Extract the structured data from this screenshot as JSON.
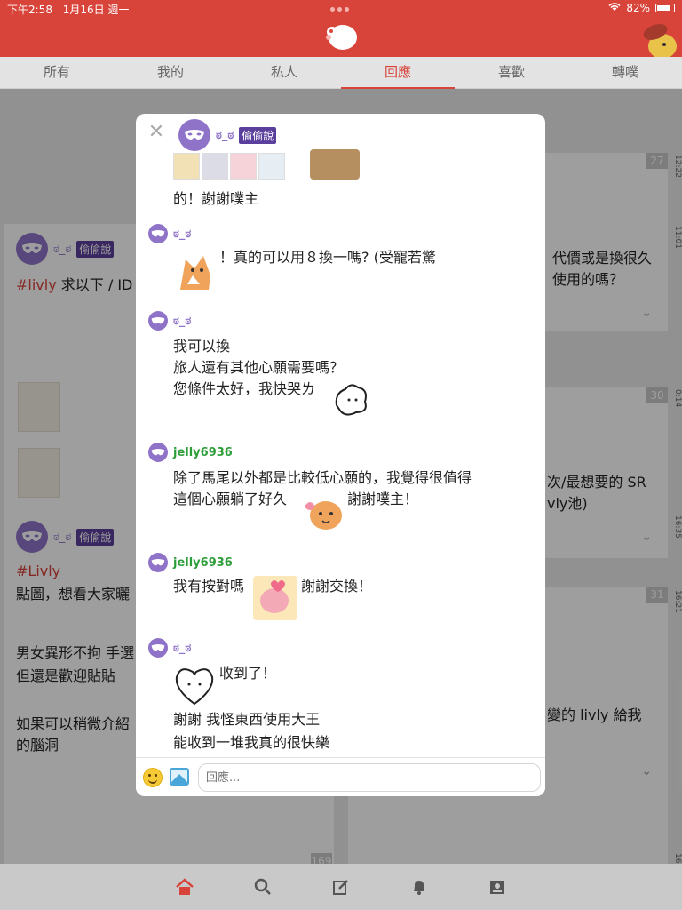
{
  "status": {
    "time": "下午2:58",
    "date": "1月16日 週一",
    "battery": "82%"
  },
  "tabs": [
    {
      "label": "所有",
      "active": false
    },
    {
      "label": "我的",
      "active": false
    },
    {
      "label": "私人",
      "active": false
    },
    {
      "label": "回應",
      "active": true
    },
    {
      "label": "喜歡",
      "active": false
    },
    {
      "label": "轉噗",
      "active": false
    }
  ],
  "feed": {
    "post1": {
      "name": "ಠ_ಠ",
      "badge": "偷偷說",
      "tag": "#livly",
      "text": " 求以下 / ID 內",
      "like_count": "",
      "timestamp": "11:01"
    },
    "post2": {
      "name": "ಠ_ಠ",
      "badge": "偷偷說",
      "tag": "#Livly",
      "line1": "點圖，想看大家曬",
      "line2": "男女異形不拘 手選",
      "line3": "但還是歡迎貼貼",
      "line4": "如果可以稍微介紹",
      "line5": "的腦洞",
      "like_count": "7"
    },
    "right1": {
      "count": "27",
      "time": "12:22",
      "line1": "代價或是換很久",
      "line2": "使用的嗎？"
    },
    "right2": {
      "count": "30",
      "time": "0:14",
      "line1": "次/最想要的 SR",
      "line2": "vly池)",
      "time2": "16:35"
    },
    "right3": {
      "count": "31",
      "time": "16:21",
      "line1": "變的 livly 給我"
    },
    "bottom_count": "169",
    "bottom_time": "16"
  },
  "modal": {
    "header": {
      "name": "ಠ_ಠ",
      "badge": "偷偷說"
    },
    "first_text": "的！謝謝噗主",
    "replies": [
      {
        "name": "ಠ_ಠ",
        "lines": [
          "！真的可以用８換一嗎? (受寵若驚"
        ]
      },
      {
        "name": "ಠ_ಠ",
        "lines": [
          "我可以換",
          "旅人還有其他心願需要嗎？",
          "您條件太好，我快哭ㄌ"
        ]
      },
      {
        "name": "jelly6936",
        "lines": [
          "除了馬尾以外都是比較低心願的，我覺得很值得",
          "這個心願躺了好久",
          "謝謝噗主！"
        ]
      },
      {
        "name": "jelly6936",
        "lines": [
          "我有按對嗎",
          "謝謝交換！"
        ]
      },
      {
        "name": "ಠ_ಠ",
        "lines": [
          "收到了！",
          "謝謝 我怪東西使用大王",
          "能收到一堆我真的很快樂"
        ]
      }
    ],
    "input_placeholder": "回應..."
  },
  "colors": {
    "brand": "#d8433a",
    "mask_purple": "#8f73c9",
    "badge_purple": "#5b3f9c",
    "green_name": "#2e9e3a"
  },
  "icons": {
    "bottom_nav": [
      "home-icon",
      "search-icon",
      "compose-icon",
      "bell-icon",
      "profile-card-icon"
    ]
  }
}
